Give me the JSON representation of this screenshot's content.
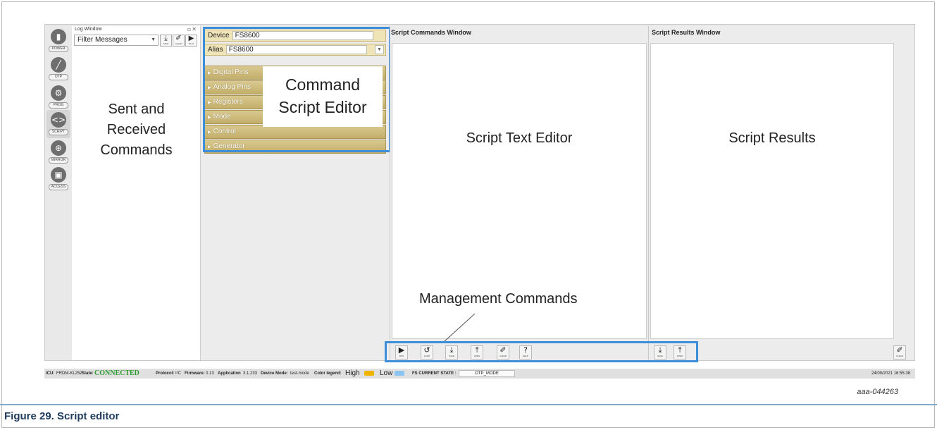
{
  "toolbar": {
    "items": [
      {
        "label": "POWER",
        "glyph": "▮"
      },
      {
        "label": "OTP",
        "glyph": "╱"
      },
      {
        "label": "PROG",
        "glyph": "⚙"
      },
      {
        "label": "SCRIPT",
        "glyph": "<>"
      },
      {
        "label": "MIRROR",
        "glyph": "⊕"
      },
      {
        "label": "ACCESS",
        "glyph": "▣"
      }
    ],
    "active": "SCRIPT"
  },
  "log_window": {
    "title": "Log Window",
    "window_controls": "▫✕",
    "filter_value": "Filter Messages",
    "buttons": [
      {
        "label": "SAVE",
        "glyph": "⤓",
        "icon": "save-icon"
      },
      {
        "label": "CLEAR",
        "glyph": "✐",
        "icon": "broom-icon"
      },
      {
        "label": "RUN",
        "glyph": "▶",
        "icon": "play-icon"
      }
    ],
    "annotation": [
      "Sent and",
      "Received",
      "Commands"
    ]
  },
  "command_panel": {
    "device_label": "Device",
    "device_value": "FS8600",
    "alias_label": "Alias",
    "alias_value": "FS8600",
    "sections": [
      "Digital Pins",
      "Analog Pins",
      "Registers",
      "Mode",
      "Control",
      "Generator"
    ],
    "annotation": [
      "Command",
      "Script Editor"
    ]
  },
  "script_window": {
    "title": "Script Commands Window",
    "annotation": "Script Text Editor",
    "buttons": [
      {
        "label": "RUN",
        "glyph": "▶",
        "icon": "play-icon"
      },
      {
        "label": "LOOP",
        "glyph": "↺",
        "icon": "loop-icon"
      },
      {
        "label": "SAVE",
        "glyph": "⤓",
        "icon": "save-icon"
      },
      {
        "label": "OPEN",
        "glyph": "⤒",
        "icon": "open-icon"
      },
      {
        "label": "CLEAR",
        "glyph": "✐",
        "icon": "broom-icon"
      },
      {
        "label": "HELP",
        "glyph": "?",
        "icon": "help-icon"
      }
    ]
  },
  "results_window": {
    "title": "Script Results Window",
    "annotation": "Script Results",
    "buttons": [
      {
        "label": "SAVE",
        "glyph": "⤓",
        "icon": "save-icon"
      },
      {
        "label": "OPEN",
        "glyph": "⤒",
        "icon": "open-icon"
      }
    ],
    "clear_button": {
      "label": "CLEAR",
      "glyph": "✐",
      "icon": "broom-icon"
    }
  },
  "management_annotation": "Management Commands",
  "status_bar": {
    "mcu_label": "ICU:",
    "mcu_value": "FRDM-KL25Z",
    "state_label": "State:",
    "state_value": "CONNECTED",
    "protocol_label": "Protocol:",
    "protocol_value": "I²C",
    "firmware_label": "Firmware:",
    "firmware_value": "0.13",
    "application_label": "Application",
    "application_value": "3.1.233",
    "device_mode_label": "Device Mode:",
    "device_mode_value": "test-mode",
    "legend_label": "Color legend:",
    "legend_high": "High",
    "legend_low": "Low",
    "fs_state_label": "FS CURRENT STATE :",
    "fs_state_value": "OTP_MODE",
    "timestamp": "24/09/2021 16:55:38",
    "colors": {
      "high": "#f0b400",
      "low": "#8cc4f0",
      "connected": "#2d9a2d"
    }
  },
  "figure": {
    "ref": "aaa-044263",
    "caption": "Figure 29.  Script editor"
  },
  "colors": {
    "highlight": "#3c8ed8",
    "accordion": "#c9b77a",
    "caption": "#1f3c5c"
  }
}
